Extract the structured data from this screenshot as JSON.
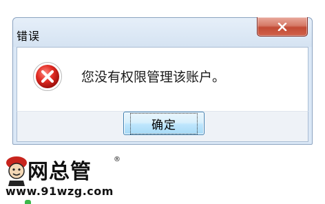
{
  "dialog": {
    "title": "错误",
    "message": "您没有权限管理该账户。",
    "ok_label": "确定",
    "icon": "error-icon",
    "close_icon": "close-icon"
  },
  "watermark": {
    "brand": "网总管",
    "registered": "®",
    "url": "www.91wzg.com",
    "logo": "mascot-logo"
  },
  "colors": {
    "frame": "#dbe8f6",
    "close_button": "#c24b35",
    "error_red": "#d42020",
    "ok_button_border": "#3c7fb1"
  }
}
